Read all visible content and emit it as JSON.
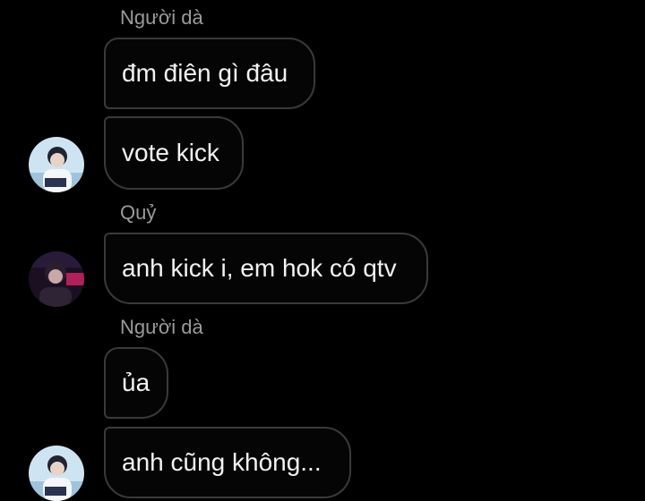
{
  "chat": {
    "messages": [
      {
        "sender": "Người dà",
        "text": "đm điên gì đâu"
      },
      {
        "sender": "",
        "text": "vote kick"
      },
      {
        "sender": "Quỷ",
        "text": "anh kick i, em hok có qtv"
      },
      {
        "sender": "Người dà",
        "text": "ủa"
      },
      {
        "sender": "",
        "text": "anh cũng không..."
      }
    ]
  },
  "avatars": [
    {
      "user": "Người dà",
      "icon": "person-photo-icon",
      "color": "#cfe4f2"
    },
    {
      "user": "Quỷ",
      "icon": "person-photo-icon",
      "color": "#1a1022"
    },
    {
      "user": "Người dà",
      "icon": "person-photo-icon",
      "color": "#cfe4f2"
    }
  ],
  "theme": {
    "background": "#000000",
    "bubble_border": "#3a3a3a",
    "text": "#f2f2f2",
    "sender_text": "#9a9a9a"
  }
}
